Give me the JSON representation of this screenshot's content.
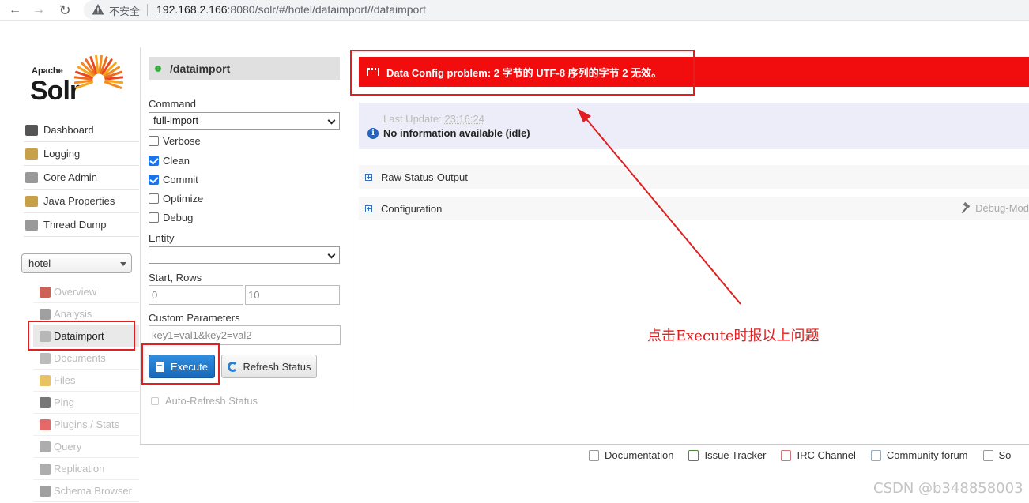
{
  "browser": {
    "back_icon": "arrow-left-icon",
    "forward_icon": "arrow-right-icon",
    "reload_icon": "reload-icon",
    "security_label": "不安全",
    "url_host": "192.168.2.166",
    "url_rest": ":8080/solr/#/hotel/dataimport//dataimport"
  },
  "logo": {
    "apache": "Apache",
    "solr": "Solr"
  },
  "main_nav": [
    {
      "label": "Dashboard",
      "icon": "dashboard-icon",
      "color": "#555"
    },
    {
      "label": "Logging",
      "icon": "logging-icon",
      "color": "#c9a04a"
    },
    {
      "label": "Core Admin",
      "icon": "core-admin-icon",
      "color": "#999"
    },
    {
      "label": "Java Properties",
      "icon": "java-properties-icon",
      "color": "#c9a04a"
    },
    {
      "label": "Thread Dump",
      "icon": "thread-dump-icon",
      "color": "#999"
    }
  ],
  "core_selector": {
    "value": "hotel"
  },
  "core_nav": [
    {
      "label": "Overview",
      "icon": "home-icon",
      "color": "#c0392b"
    },
    {
      "label": "Analysis",
      "icon": "funnel-icon",
      "color": "#888"
    },
    {
      "label": "Dataimport",
      "icon": "document-import-icon",
      "color": "#aaa"
    },
    {
      "label": "Documents",
      "icon": "documents-icon",
      "color": "#aaa"
    },
    {
      "label": "Files",
      "icon": "files-icon",
      "color": "#e2b33c"
    },
    {
      "label": "Ping",
      "icon": "ping-icon",
      "color": "#555"
    },
    {
      "label": "Plugins / Stats",
      "icon": "plugins-icon",
      "color": "#d44"
    },
    {
      "label": "Query",
      "icon": "query-icon",
      "color": "#999"
    },
    {
      "label": "Replication",
      "icon": "replication-icon",
      "color": "#999"
    },
    {
      "label": "Schema Browser",
      "icon": "schema-browser-icon",
      "color": "#888"
    }
  ],
  "handler": {
    "name": "/dataimport",
    "status_color": "#3cb043"
  },
  "form": {
    "command_label": "Command",
    "command_value": "full-import",
    "checkboxes": [
      {
        "label": "Verbose",
        "checked": false
      },
      {
        "label": "Clean",
        "checked": true
      },
      {
        "label": "Commit",
        "checked": true
      },
      {
        "label": "Optimize",
        "checked": false
      },
      {
        "label": "Debug",
        "checked": false
      }
    ],
    "entity_label": "Entity",
    "entity_value": "",
    "start_rows_label": "Start, Rows",
    "start_value": "0",
    "rows_value": "10",
    "custom_params_label": "Custom Parameters",
    "custom_params_value": "key1=val1&key2=val2",
    "execute_label": "Execute",
    "refresh_label": "Refresh Status",
    "auto_refresh_label": "Auto-Refresh Status"
  },
  "error": {
    "message": "Data Config problem: 2 字节的 UTF-8 序列的字节 2 无效。",
    "color": "#f10d0d"
  },
  "status": {
    "last_update_label": "Last Update:",
    "last_update_time": "23:16:24",
    "info_text": "No information available (idle)"
  },
  "sections": {
    "raw_status": "Raw Status-Output",
    "configuration": "Configuration",
    "debug_mode": "Debug-Mod"
  },
  "footer": [
    {
      "label": "Documentation",
      "icon": "documentation-icon",
      "color": "#999"
    },
    {
      "label": "Issue Tracker",
      "icon": "bug-icon",
      "color": "#4a8a3a"
    },
    {
      "label": "IRC Channel",
      "icon": "irc-icon",
      "color": "#c77"
    },
    {
      "label": "Community forum",
      "icon": "mail-icon",
      "color": "#9ab"
    },
    {
      "label": "So",
      "icon": "solr-query-syntax-icon",
      "color": "#999"
    }
  ],
  "annotation": {
    "text": "点击Execute时报以上问题",
    "color": "#e02020"
  },
  "watermark": "CSDN @b348858003"
}
